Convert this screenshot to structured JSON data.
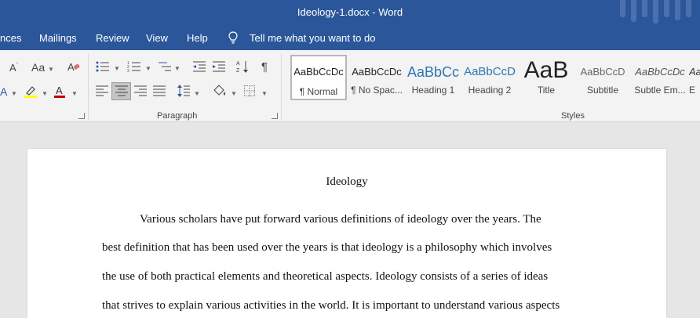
{
  "window": {
    "title": "Ideology-1.docx  -  Word"
  },
  "menu": {
    "references_partial": "nces",
    "mailings": "Mailings",
    "review": "Review",
    "view": "View",
    "help": "Help",
    "tell_me": "Tell me what you want to do"
  },
  "ribbon": {
    "change_case": "Aa",
    "paragraph_label": "Paragraph",
    "styles_label": "Styles",
    "styles": [
      {
        "preview": "AaBbCcDc",
        "name": "¶ Normal"
      },
      {
        "preview": "AaBbCcDc",
        "name": "¶ No Spac..."
      },
      {
        "preview": "AaBbCc",
        "name": "Heading 1"
      },
      {
        "preview": "AaBbCcD",
        "name": "Heading 2"
      },
      {
        "preview": "AaB",
        "name": "Title"
      },
      {
        "preview": "AaBbCcD",
        "name": "Subtitle"
      },
      {
        "preview": "AaBbCcDc",
        "name": "Subtle Em..."
      },
      {
        "preview": "Aa",
        "name": "E"
      }
    ]
  },
  "colors": {
    "accent": "#2b579a",
    "highlight": "#ffff00",
    "font_color": "#c00000"
  },
  "document": {
    "title": "Ideology",
    "lines": [
      "Various scholars have put forward various definitions of ideology over the years. The",
      "best definition that has been used over the years is that ideology is a philosophy which involves",
      "the use of both practical elements and theoretical aspects. Ideology consists of a series of ideas",
      "that strives to explain various activities in the world. It is important to understand various aspects"
    ]
  }
}
